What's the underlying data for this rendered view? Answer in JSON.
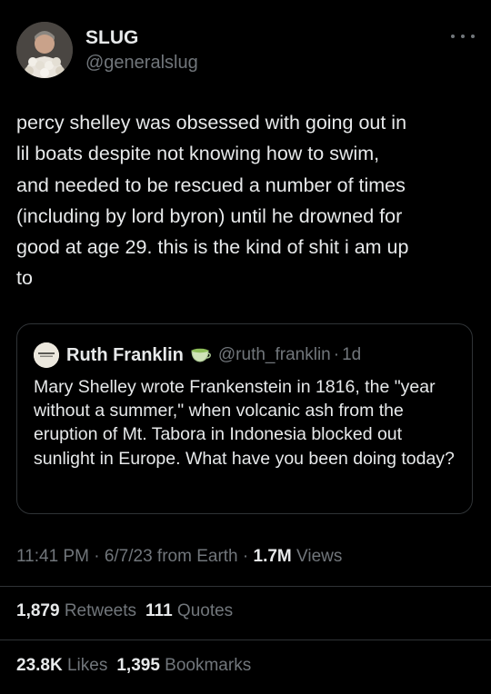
{
  "author": {
    "display_name": "SLUG",
    "handle": "@generalslug"
  },
  "tweet": {
    "text": "percy shelley was obsessed with going out in\nlil boats despite not knowing how to swim,\nand needed to be rescued a number of times\n(including by lord byron) until he drowned for\ngood at age 29. this is the kind of shit i am up\nto"
  },
  "quote": {
    "name": "Ruth Franklin",
    "handle": "@ruth_franklin",
    "separator": "·",
    "time": "1d",
    "text": "Mary Shelley wrote Frankenstein in 1816, the \"year without a summer,\" when volcanic ash from the eruption of Mt. Tabora in Indonesia blocked out sunlight in Europe. What have you been doing today?"
  },
  "meta": {
    "time": "11:41 PM",
    "sep1": " · ",
    "date": "6/7/23",
    "source": " from Earth",
    "sep2": " · ",
    "views_count": "1.7M",
    "views_label": " Views"
  },
  "stats": {
    "retweets_count": "1,879",
    "retweets_label": "Retweets",
    "quotes_count": "111",
    "quotes_label": "Quotes",
    "likes_count": "23.8K",
    "likes_label": "Likes",
    "bookmarks_count": "1,395",
    "bookmarks_label": "Bookmarks"
  },
  "icons": {
    "more": "more-horizontal-icon",
    "tea": "tea-cup-icon"
  },
  "colors": {
    "background": "#000000",
    "text": "#e7e9ea",
    "secondary": "#71767b",
    "border": "#2f3336"
  }
}
